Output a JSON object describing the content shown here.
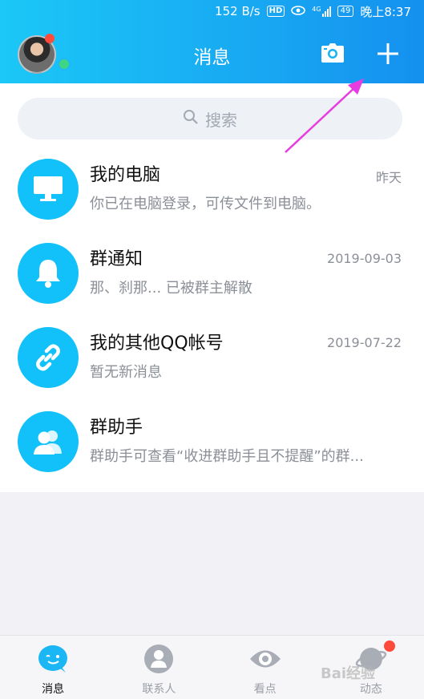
{
  "status_bar": {
    "speed": "152 B/s",
    "hd": "HD",
    "network": "4G",
    "battery": "49",
    "time": "晚上8:37"
  },
  "header": {
    "title": "消息",
    "camera_icon": "camera-icon",
    "add_icon": "plus-icon"
  },
  "search": {
    "placeholder": "搜索"
  },
  "conversations": [
    {
      "title": "我的电脑",
      "subtitle": "你已在电脑登录，可传文件到电脑。",
      "time": "昨天",
      "icon": "monitor-icon"
    },
    {
      "title": "群通知",
      "subtitle": "那、刹那... 已被群主解散",
      "time": "2019-09-03",
      "icon": "bell-icon"
    },
    {
      "title": "我的其他QQ帐号",
      "subtitle": "暂无新消息",
      "time": "2019-07-22",
      "icon": "link-icon"
    },
    {
      "title": "群助手",
      "subtitle": "群助手可查看“收进群助手且不提醒”的群...",
      "time": "",
      "icon": "group-icon"
    }
  ],
  "tabs": [
    {
      "label": "消息",
      "icon": "chat-bubble-icon",
      "active": true
    },
    {
      "label": "联系人",
      "icon": "contact-icon",
      "active": false
    },
    {
      "label": "看点",
      "icon": "eye-icon",
      "active": false
    },
    {
      "label": "动态",
      "icon": "planet-icon",
      "active": false
    }
  ],
  "watermark": "Bai经验",
  "colors": {
    "header_start": "#1bc8f7",
    "header_end": "#1490ef",
    "icon_blue": "#12c1f9",
    "badge_red": "#ff4b3a",
    "online_green": "#3ed684",
    "arrow_magenta": "#e63ce0"
  }
}
